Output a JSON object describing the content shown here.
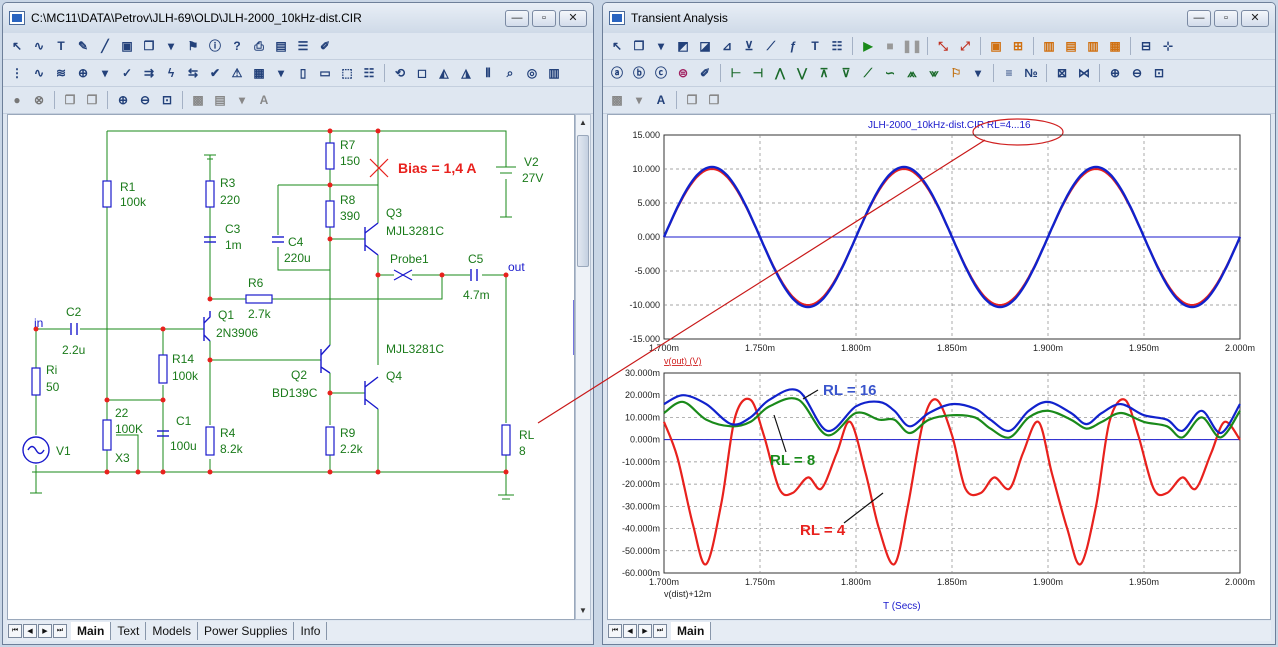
{
  "schematic_window": {
    "title": "C:\\MC11\\DATA\\Petrov\\JLH-69\\OLD\\JLH-2000_10kHz-dist.CIR",
    "tabs": [
      "Main",
      "Text",
      "Models",
      "Power Supplies",
      "Info"
    ],
    "active_tab": "Main",
    "components": {
      "r1": "R1",
      "r1_val": "100k",
      "r3": "R3",
      "r3_val": "220",
      "c3": "C3",
      "c3_val": "1m",
      "r7": "R7",
      "r7_val": "150",
      "r8": "R8",
      "r8_val": "390",
      "c4": "C4",
      "c4_val": "220u",
      "q3": "Q3",
      "q3_model": "MJL3281C",
      "v2": "V2",
      "v2_val": "27V",
      "bias_note": "Bias = 1,4 A",
      "probe": "Probe1",
      "c5": "C5",
      "c5_val": "4.7m",
      "out": "out",
      "r6": "R6",
      "r6_val": "2.7k",
      "in": "in",
      "c2": "C2",
      "c2_val": "2.2u",
      "q1": "Q1",
      "q1_model": "2N3906",
      "r14": "R14",
      "r14_val": "100k",
      "ri": "Ri",
      "ri_val": "50",
      "pot_a": "22",
      "pot_b": "100K",
      "x3": "X3",
      "c1": "C1",
      "c1_val": "100u",
      "q2": "Q2",
      "q2_model": "BD139C",
      "q4": "Q4",
      "q4_model": "MJL3281C",
      "r4": "R4",
      "r4_val": "8.2k",
      "r9": "R9",
      "r9_val": "2.2k",
      "v1": "V1",
      "rl": "RL",
      "rl_val": "8"
    }
  },
  "analysis_window": {
    "title": "Transient Analysis",
    "tabs": [
      "Main"
    ],
    "active_tab": "Main",
    "plot_title": "JLH-2000_10kHz-dist.CIR RL=4...16",
    "x_tick_labels": [
      "1.700m",
      "1.750m",
      "1.800m",
      "1.850m",
      "1.900m",
      "1.950m",
      "2.000m"
    ],
    "x_axis_title": "T (Secs)",
    "colors": {
      "red": "#e8211d",
      "blue": "#1122cc",
      "green": "#1a8a1a",
      "axis": "#1a1acc"
    },
    "top_plot": {
      "y_tick_labels": [
        "15.000",
        "10.000",
        "5.000",
        "0.000",
        "-5.000",
        "-10.000",
        "-15.000"
      ],
      "trace_label": "v(out) (V)",
      "chart_data": {
        "type": "line",
        "x_range": [
          0.0017,
          0.002
        ],
        "ylim": [
          -15,
          15
        ],
        "frequency_hz": 10000,
        "series": [
          {
            "color": "#e8211d",
            "amplitude": 10.0
          },
          {
            "color": "#1122cc",
            "amplitude": 10.3
          }
        ]
      }
    },
    "bottom_plot": {
      "y_tick_labels": [
        "30.000m",
        "20.000m",
        "10.000m",
        "0.000m",
        "-10.000m",
        "-20.000m",
        "-30.000m",
        "-40.000m",
        "-50.000m",
        "-60.000m"
      ],
      "trace_label": "v(dist)+12m",
      "annotations": {
        "rl16": "RL = 16",
        "rl8": "RL = 8",
        "rl4": "RL = 4"
      },
      "chart_data": {
        "type": "line",
        "x_range": [
          0.0017,
          0.002
        ],
        "ylim": [
          -60,
          30
        ],
        "series": [
          {
            "name": "RL = 16",
            "color": "#1122cc",
            "x": [
              1.7,
              1.71,
              1.722,
              1.735,
              1.745,
              1.755,
              1.77,
              1.785,
              1.8,
              1.812,
              1.82,
              1.828,
              1.838,
              1.85,
              1.862,
              1.87,
              1.88,
              1.89,
              1.9,
              1.912,
              1.92,
              1.928,
              1.938,
              1.95,
              1.962,
              1.97,
              1.98,
              1.99,
              2.0
            ],
            "y": [
              16,
              20,
              16,
              7,
              10,
              18,
              22,
              4,
              15,
              17,
              13,
              6,
              12,
              16,
              14,
              9,
              4,
              13,
              17,
              12,
              7,
              12,
              16,
              11,
              9,
              4,
              13,
              3,
              16
            ]
          },
          {
            "name": "RL = 8",
            "color": "#1a8a1a",
            "x": [
              1.7,
              1.71,
              1.722,
              1.735,
              1.745,
              1.755,
              1.77,
              1.785,
              1.8,
              1.812,
              1.82,
              1.828,
              1.838,
              1.85,
              1.862,
              1.87,
              1.88,
              1.89,
              1.9,
              1.912,
              1.92,
              1.928,
              1.938,
              1.95,
              1.962,
              1.97,
              1.98,
              1.99,
              2.0
            ],
            "y": [
              12,
              17,
              9,
              6,
              8,
              15,
              18,
              2,
              12,
              9,
              9,
              3,
              9,
              11,
              10,
              5,
              1,
              10,
              13,
              9,
              5,
              8,
              12,
              8,
              6,
              1,
              10,
              1,
              13
            ]
          },
          {
            "name": "RL = 4",
            "color": "#e8211d",
            "x": [
              1.7,
              1.707,
              1.715,
              1.722,
              1.73,
              1.737,
              1.745,
              1.752,
              1.76,
              1.767,
              1.775,
              1.782,
              1.79,
              1.797,
              1.805,
              1.812,
              1.82,
              1.827,
              1.835,
              1.842,
              1.85,
              1.857,
              1.865,
              1.872,
              1.88,
              1.887,
              1.895,
              1.902,
              1.91,
              1.917,
              1.925,
              1.932,
              1.94,
              1.947,
              1.955,
              1.962,
              1.97,
              1.977,
              1.985,
              1.992,
              2.0
            ],
            "y": [
              8,
              -8,
              -38,
              -56,
              -28,
              10,
              18,
              2,
              -22,
              -24,
              -17,
              -22,
              -6,
              8,
              -15,
              -40,
              -56,
              -30,
              8,
              18,
              2,
              -22,
              -24,
              -17,
              -22,
              -6,
              8,
              -15,
              -40,
              -56,
              -30,
              8,
              18,
              2,
              -22,
              -24,
              -17,
              -22,
              -6,
              8,
              0
            ]
          }
        ]
      }
    }
  }
}
